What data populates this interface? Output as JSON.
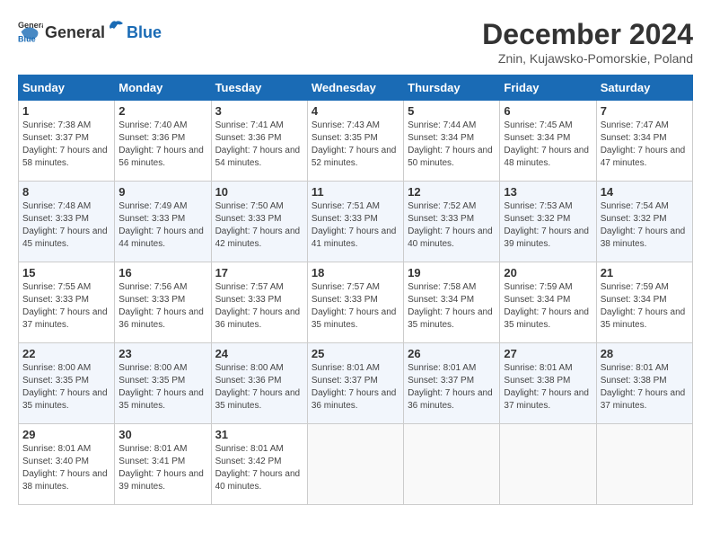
{
  "header": {
    "logo_general": "General",
    "logo_blue": "Blue",
    "month_title": "December 2024",
    "location": "Znin, Kujawsko-Pomorskie, Poland"
  },
  "weekdays": [
    "Sunday",
    "Monday",
    "Tuesday",
    "Wednesday",
    "Thursday",
    "Friday",
    "Saturday"
  ],
  "weeks": [
    [
      {
        "day": "1",
        "sunrise": "7:38 AM",
        "sunset": "3:37 PM",
        "daylight": "7 hours and 58 minutes."
      },
      {
        "day": "2",
        "sunrise": "7:40 AM",
        "sunset": "3:36 PM",
        "daylight": "7 hours and 56 minutes."
      },
      {
        "day": "3",
        "sunrise": "7:41 AM",
        "sunset": "3:36 PM",
        "daylight": "7 hours and 54 minutes."
      },
      {
        "day": "4",
        "sunrise": "7:43 AM",
        "sunset": "3:35 PM",
        "daylight": "7 hours and 52 minutes."
      },
      {
        "day": "5",
        "sunrise": "7:44 AM",
        "sunset": "3:34 PM",
        "daylight": "7 hours and 50 minutes."
      },
      {
        "day": "6",
        "sunrise": "7:45 AM",
        "sunset": "3:34 PM",
        "daylight": "7 hours and 48 minutes."
      },
      {
        "day": "7",
        "sunrise": "7:47 AM",
        "sunset": "3:34 PM",
        "daylight": "7 hours and 47 minutes."
      }
    ],
    [
      {
        "day": "8",
        "sunrise": "7:48 AM",
        "sunset": "3:33 PM",
        "daylight": "7 hours and 45 minutes."
      },
      {
        "day": "9",
        "sunrise": "7:49 AM",
        "sunset": "3:33 PM",
        "daylight": "7 hours and 44 minutes."
      },
      {
        "day": "10",
        "sunrise": "7:50 AM",
        "sunset": "3:33 PM",
        "daylight": "7 hours and 42 minutes."
      },
      {
        "day": "11",
        "sunrise": "7:51 AM",
        "sunset": "3:33 PM",
        "daylight": "7 hours and 41 minutes."
      },
      {
        "day": "12",
        "sunrise": "7:52 AM",
        "sunset": "3:33 PM",
        "daylight": "7 hours and 40 minutes."
      },
      {
        "day": "13",
        "sunrise": "7:53 AM",
        "sunset": "3:32 PM",
        "daylight": "7 hours and 39 minutes."
      },
      {
        "day": "14",
        "sunrise": "7:54 AM",
        "sunset": "3:32 PM",
        "daylight": "7 hours and 38 minutes."
      }
    ],
    [
      {
        "day": "15",
        "sunrise": "7:55 AM",
        "sunset": "3:33 PM",
        "daylight": "7 hours and 37 minutes."
      },
      {
        "day": "16",
        "sunrise": "7:56 AM",
        "sunset": "3:33 PM",
        "daylight": "7 hours and 36 minutes."
      },
      {
        "day": "17",
        "sunrise": "7:57 AM",
        "sunset": "3:33 PM",
        "daylight": "7 hours and 36 minutes."
      },
      {
        "day": "18",
        "sunrise": "7:57 AM",
        "sunset": "3:33 PM",
        "daylight": "7 hours and 35 minutes."
      },
      {
        "day": "19",
        "sunrise": "7:58 AM",
        "sunset": "3:34 PM",
        "daylight": "7 hours and 35 minutes."
      },
      {
        "day": "20",
        "sunrise": "7:59 AM",
        "sunset": "3:34 PM",
        "daylight": "7 hours and 35 minutes."
      },
      {
        "day": "21",
        "sunrise": "7:59 AM",
        "sunset": "3:34 PM",
        "daylight": "7 hours and 35 minutes."
      }
    ],
    [
      {
        "day": "22",
        "sunrise": "8:00 AM",
        "sunset": "3:35 PM",
        "daylight": "7 hours and 35 minutes."
      },
      {
        "day": "23",
        "sunrise": "8:00 AM",
        "sunset": "3:35 PM",
        "daylight": "7 hours and 35 minutes."
      },
      {
        "day": "24",
        "sunrise": "8:00 AM",
        "sunset": "3:36 PM",
        "daylight": "7 hours and 35 minutes."
      },
      {
        "day": "25",
        "sunrise": "8:01 AM",
        "sunset": "3:37 PM",
        "daylight": "7 hours and 36 minutes."
      },
      {
        "day": "26",
        "sunrise": "8:01 AM",
        "sunset": "3:37 PM",
        "daylight": "7 hours and 36 minutes."
      },
      {
        "day": "27",
        "sunrise": "8:01 AM",
        "sunset": "3:38 PM",
        "daylight": "7 hours and 37 minutes."
      },
      {
        "day": "28",
        "sunrise": "8:01 AM",
        "sunset": "3:38 PM",
        "daylight": "7 hours and 37 minutes."
      }
    ],
    [
      {
        "day": "29",
        "sunrise": "8:01 AM",
        "sunset": "3:40 PM",
        "daylight": "7 hours and 38 minutes."
      },
      {
        "day": "30",
        "sunrise": "8:01 AM",
        "sunset": "3:41 PM",
        "daylight": "7 hours and 39 minutes."
      },
      {
        "day": "31",
        "sunrise": "8:01 AM",
        "sunset": "3:42 PM",
        "daylight": "7 hours and 40 minutes."
      },
      null,
      null,
      null,
      null
    ]
  ]
}
